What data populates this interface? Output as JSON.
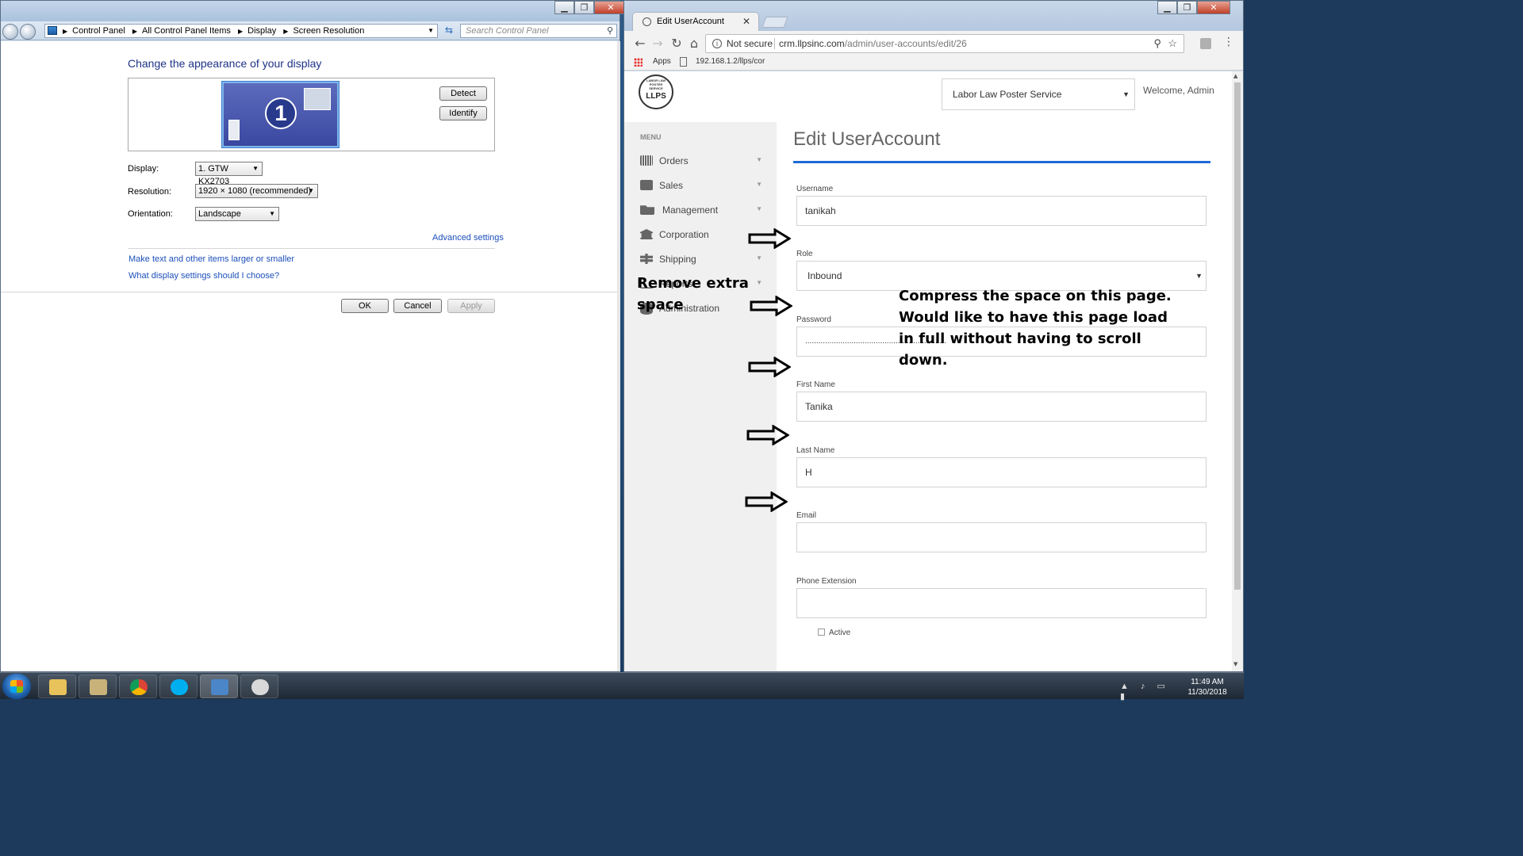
{
  "control_panel": {
    "breadcrumbs": [
      "Control Panel",
      "All Control Panel Items",
      "Display",
      "Screen Resolution"
    ],
    "search_placeholder": "Search Control Panel",
    "heading": "Change the appearance of your display",
    "monitor_number": "1",
    "detect_label": "Detect",
    "identify_label": "Identify",
    "display_label": "Display:",
    "display_value": "1. GTW KX2703",
    "resolution_label": "Resolution:",
    "resolution_value": "1920 × 1080 (recommended)",
    "orientation_label": "Orientation:",
    "orientation_value": "Landscape",
    "advanced_link": "Advanced settings",
    "link_text_size": "Make text and other items larger or smaller",
    "link_display_settings": "What display settings should I choose?",
    "ok_label": "OK",
    "cancel_label": "Cancel",
    "apply_label": "Apply"
  },
  "browser": {
    "tab_title": "Edit UserAccount",
    "not_secure": "Not secure",
    "url_host": "crm.llpsinc.com",
    "url_path": "/admin/user-accounts/edit/26",
    "bookmark_apps": "Apps",
    "bookmark_link": "192.168.1.2/llps/cor"
  },
  "app": {
    "logo_text": "LLPS",
    "logo_ring": "LABOR LAW POSTER SERVICE",
    "company_select": "Labor Law Poster Service",
    "welcome": "Welcome, Admin",
    "menu_heading": "MENU",
    "menu": [
      {
        "label": "Orders",
        "icon": "barcode-icon",
        "expandable": true
      },
      {
        "label": "Sales",
        "icon": "id-card-icon",
        "expandable": true
      },
      {
        "label": "Management",
        "icon": "folder-open-icon",
        "expandable": true
      },
      {
        "label": "Corporation",
        "icon": "bank-icon",
        "expandable": false
      },
      {
        "label": "Shipping",
        "icon": "signpost-icon",
        "expandable": true
      },
      {
        "label": "Reports",
        "icon": "line-chart-icon",
        "expandable": true
      },
      {
        "label": "Administration",
        "icon": "database-icon",
        "expandable": true
      }
    ],
    "page_title": "Edit UserAccount",
    "form": {
      "username_label": "Username",
      "username_value": "tanikah",
      "role_label": "Role",
      "role_value": "Inbound",
      "password_label": "Password",
      "password_value": "................................................................",
      "first_name_label": "First Name",
      "first_name_value": "Tanika",
      "last_name_label": "Last Name",
      "last_name_value": "H",
      "email_label": "Email",
      "email_value": "",
      "phone_ext_label": "Phone Extension",
      "phone_ext_value": "",
      "active_label": "Active",
      "active_checked": false
    },
    "annotation_left": "Remove extra space",
    "annotation_right": "Compress the space on this page. Would like to have this page load in full without having to scroll down."
  },
  "taskbar": {
    "time": "11:49 AM",
    "date": "11/30/2018"
  },
  "colors": {
    "accent": "#1e6bd9",
    "link": "#1c4fba",
    "cp_heading": "#1e3287"
  }
}
